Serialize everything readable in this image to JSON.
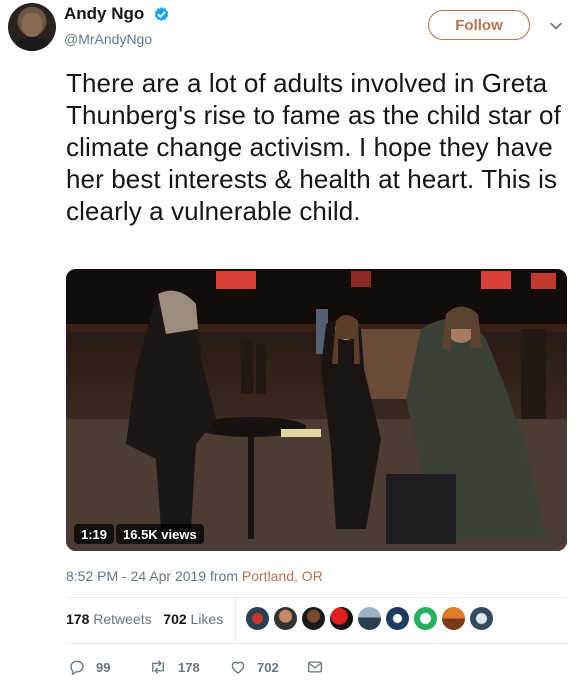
{
  "user": {
    "name": "Andy Ngo",
    "handle": "@MrAndyNgo",
    "verified": true
  },
  "follow": {
    "label": "Follow"
  },
  "tweet": {
    "text": "There are a lot of adults involved in Greta Thunberg's rise to fame as the child star of climate change activism. I hope they have her best interests & health at heart. This is clearly a vulnerable child."
  },
  "video": {
    "duration": "1:19",
    "views": "16.5K views"
  },
  "meta": {
    "time": "8:52 PM - 24 Apr 2019 from ",
    "location": "Portland, OR"
  },
  "stats": {
    "retweets_count": "178",
    "retweets_label": "Retweets",
    "likes_count": "702",
    "likes_label": "Likes"
  },
  "likers": [
    "avatar-1",
    "avatar-2",
    "avatar-3",
    "avatar-4",
    "avatar-5",
    "avatar-6",
    "avatar-7",
    "avatar-8",
    "avatar-9"
  ],
  "actions": {
    "replies": "99",
    "retweets": "178",
    "likes": "702"
  },
  "colors": {
    "accent": "#b8724f",
    "verified": "#1da1f2",
    "muted": "#657786"
  }
}
